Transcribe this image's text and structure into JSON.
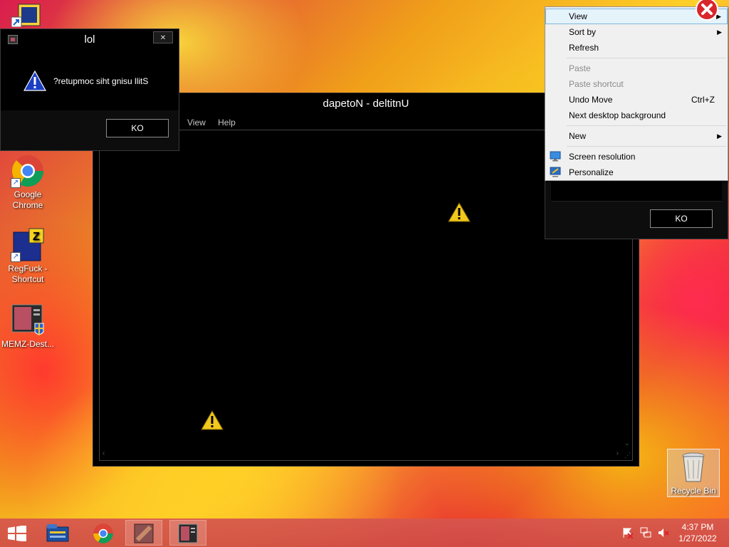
{
  "desktop": {
    "icons": [
      {
        "label": "Google Chrome"
      },
      {
        "label": "RegFuck - Shortcut"
      },
      {
        "label": "MEMZ-Dest..."
      },
      {
        "label": "Recycle Bin"
      }
    ]
  },
  "message_box_1": {
    "title": "lol",
    "message": "?retupmoc siht gnisu llitS",
    "ok_label": "KO",
    "close_glyph": "✕"
  },
  "notepad": {
    "title": "dapetoN - deltitnU",
    "menu": [
      "View",
      "Help"
    ]
  },
  "message_box_2": {
    "ok_label": "KO"
  },
  "context_menu": {
    "items": [
      {
        "label": "View",
        "submenu": true,
        "state": "hover"
      },
      {
        "label": "Sort by",
        "submenu": true
      },
      {
        "label": "Refresh"
      },
      {
        "separator": true
      },
      {
        "label": "Paste",
        "state": "disabled"
      },
      {
        "label": "Paste shortcut",
        "state": "disabled"
      },
      {
        "label": "Undo Move",
        "shortcut": "Ctrl+Z"
      },
      {
        "label": "Next desktop background"
      },
      {
        "separator": true
      },
      {
        "label": "New",
        "submenu": true
      },
      {
        "separator": true
      },
      {
        "label": "Screen resolution",
        "icon": "monitor-icon"
      },
      {
        "label": "Personalize",
        "icon": "personalize-icon"
      }
    ]
  },
  "taskbar": {
    "time": "4:37 PM",
    "date": "1/27/2022"
  },
  "colors": {
    "warning_yellow": "#f2c81e",
    "error_red": "#d9262c",
    "menu_hover": "#e5f3fb"
  }
}
